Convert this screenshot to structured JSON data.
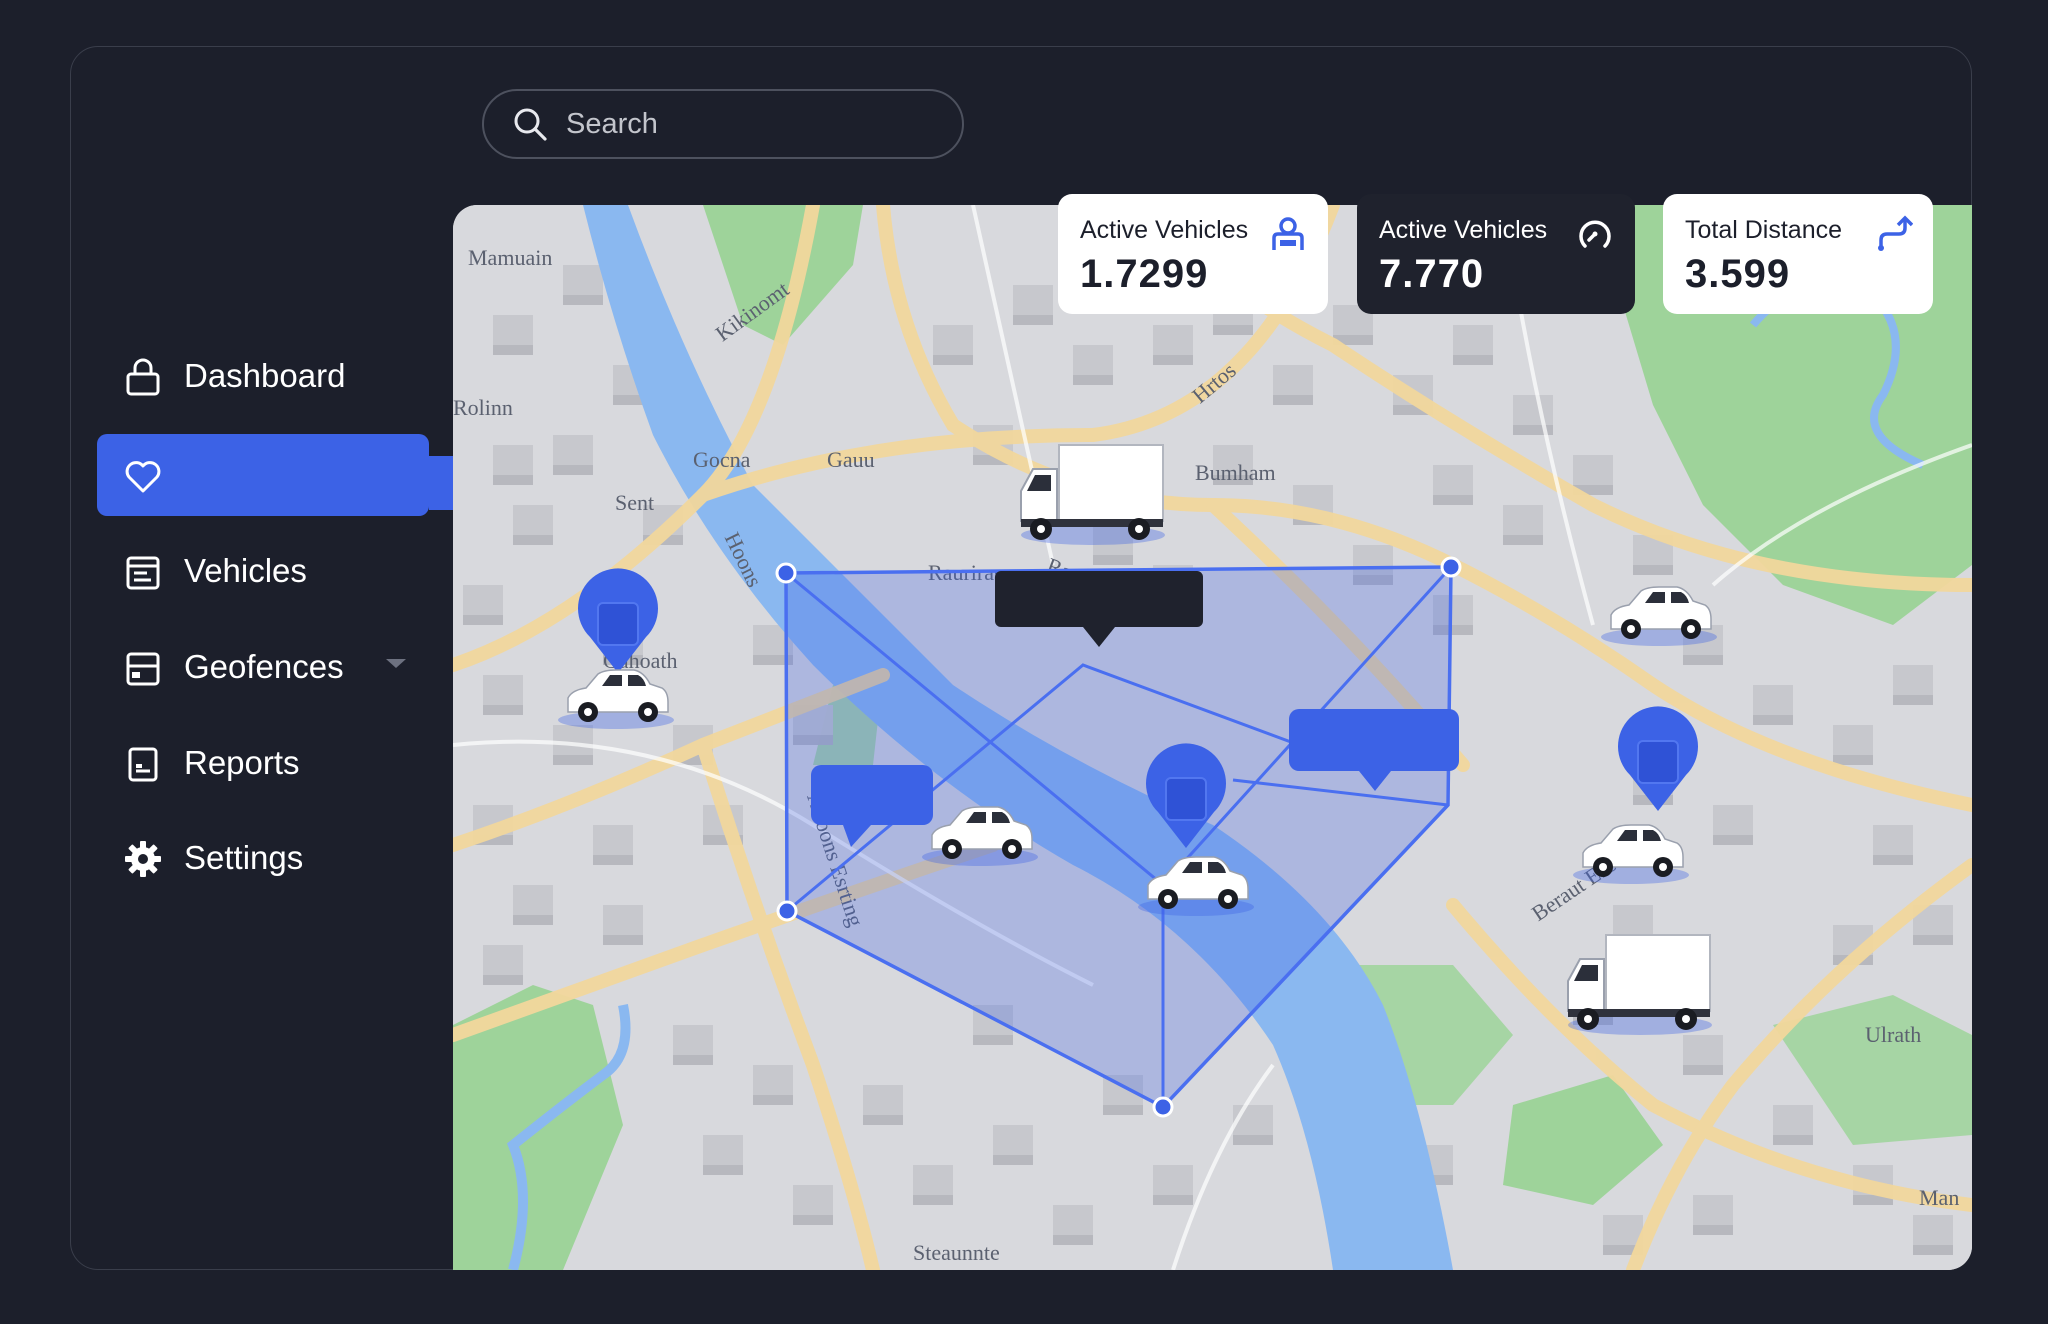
{
  "search": {
    "placeholder": "Search",
    "icon": "search-icon"
  },
  "sidebar": {
    "items": [
      {
        "label": "Dashboard",
        "icon": "lock-icon",
        "active": false
      },
      {
        "label": "",
        "icon": "heart-icon",
        "active": true
      },
      {
        "label": "Vehicles",
        "icon": "calendar-icon",
        "active": false
      },
      {
        "label": "Geofences",
        "icon": "inbox-icon",
        "active": false,
        "has_dropdown": true
      },
      {
        "label": "Reports",
        "icon": "document-icon",
        "active": false
      },
      {
        "label": "Settings",
        "icon": "gear-icon",
        "active": false
      }
    ]
  },
  "stats": [
    {
      "label": "Active Vehicles",
      "value": "1.7299",
      "icon": "driver-icon",
      "theme": "light"
    },
    {
      "label": "Active Vehicles",
      "value": "7.770",
      "icon": "speedometer-icon",
      "theme": "dark"
    },
    {
      "label": "Total Distance",
      "value": "3.599",
      "icon": "route-icon",
      "theme": "light"
    }
  ],
  "map": {
    "labels": [
      "Mamuain",
      "Kikinomt",
      "Gocna",
      "Gauu",
      "Bumham",
      "Sent",
      "Hrtos",
      "Rauwinar",
      "Gahoath",
      "Rauriras",
      "Aitoons Esrting",
      "Beraut Esons",
      "Ulrath",
      "Man",
      "Steaunnte",
      "Hoons",
      "Rolinn"
    ],
    "accent": "#3c62e6",
    "water": "#8ab8f0",
    "park": "#9ed39a"
  }
}
